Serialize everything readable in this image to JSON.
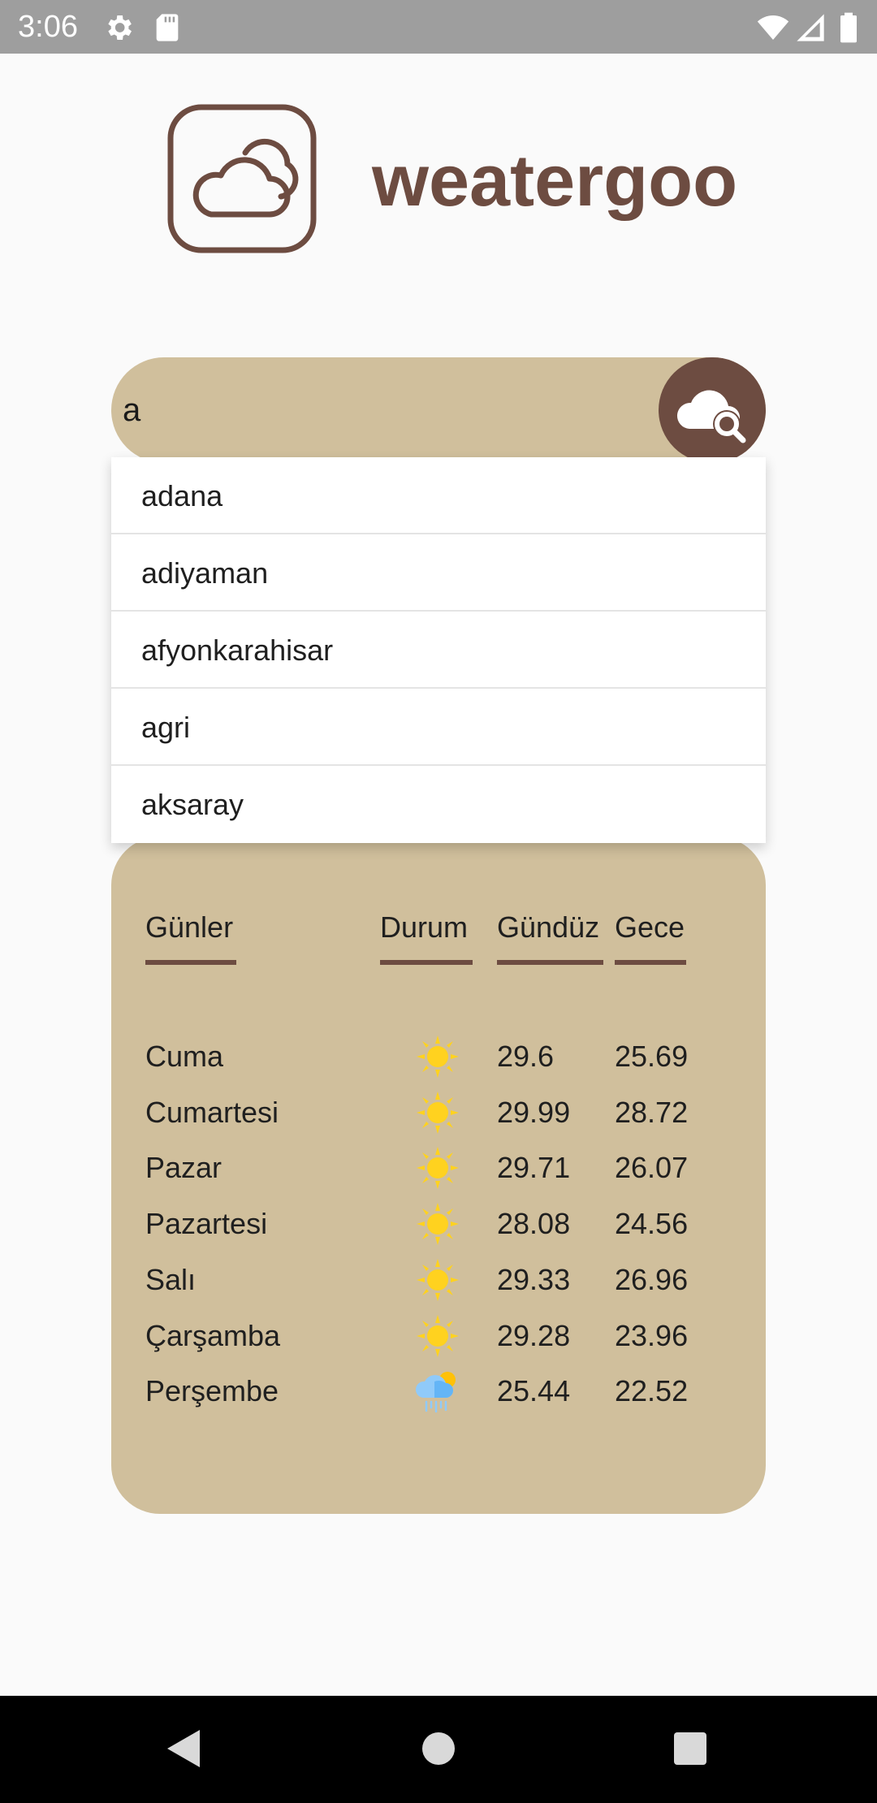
{
  "status_bar": {
    "time": "3:06",
    "icons": [
      "gear-icon",
      "sd-card-icon",
      "wifi-icon",
      "signal-icon",
      "battery-icon"
    ]
  },
  "app": {
    "title": "weatergoo",
    "logo_icon": "cloud-icon"
  },
  "search": {
    "value": "a",
    "button_icon": "cloud-search-icon"
  },
  "suggestions": [
    {
      "label": "adana"
    },
    {
      "label": "adiyaman"
    },
    {
      "label": "afyonkarahisar"
    },
    {
      "label": "agri"
    },
    {
      "label": "aksaray"
    }
  ],
  "forecast": {
    "headers": {
      "days": "Günler",
      "status": "Durum",
      "day_temp": "Gündüz",
      "night_temp": "Gece"
    },
    "rows": [
      {
        "day": "Cuma",
        "icon": "sun-icon",
        "day_temp": "29.6",
        "night_temp": "25.69"
      },
      {
        "day": "Cumartesi",
        "icon": "sun-icon",
        "day_temp": "29.99",
        "night_temp": "28.72"
      },
      {
        "day": "Pazar",
        "icon": "sun-icon",
        "day_temp": "29.71",
        "night_temp": "26.07"
      },
      {
        "day": "Pazartesi",
        "icon": "sun-icon",
        "day_temp": "28.08",
        "night_temp": "24.56"
      },
      {
        "day": "Salı",
        "icon": "sun-icon",
        "day_temp": "29.33",
        "night_temp": "26.96"
      },
      {
        "day": "Çarşamba",
        "icon": "sun-icon",
        "day_temp": "29.28",
        "night_temp": "23.96"
      },
      {
        "day": "Perşembe",
        "icon": "rain-sun-icon",
        "day_temp": "25.44",
        "night_temp": "22.52"
      }
    ]
  },
  "colors": {
    "brand_brown": "#6d4c41",
    "card_tan": "#d0bf9c",
    "status_bar": "#9e9e9e",
    "background": "#fafafa"
  },
  "nav_bar": {
    "buttons": [
      "back-icon",
      "home-icon",
      "recents-icon"
    ]
  }
}
